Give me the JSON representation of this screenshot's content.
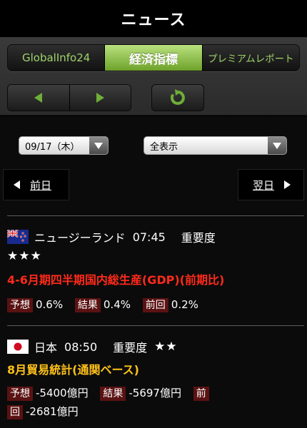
{
  "header": {
    "title": "ニュース"
  },
  "tabs": [
    {
      "label": "GlobalInfo24",
      "active": false
    },
    {
      "label": "経済指標",
      "active": true
    },
    {
      "label": "プレミアムレポート",
      "active": false
    }
  ],
  "filters": {
    "date_value": "09/17（木）",
    "display_value": "全表示"
  },
  "day_nav": {
    "prev_label": "前日",
    "next_label": "翌日"
  },
  "colors": {
    "accent_green": "#6fae38",
    "red_title": "#ff2a1a",
    "yellow_title": "#ffc21a",
    "label_bg": "#5a1212"
  },
  "events": [
    {
      "country": "ニュージーランド",
      "time": "07:45",
      "importance_label": "重要度",
      "stars": "★★★",
      "title": "4-6月期四半期国内総生産(GDP)(前期比)",
      "forecast_label": "予想",
      "forecast": "0.6%",
      "result_label": "結果",
      "result": "0.4%",
      "previous_label": "前回",
      "previous": "0.2%",
      "flag_icon": "nz-flag-icon"
    },
    {
      "country": "日本",
      "time": "08:50",
      "importance_label": "重要度",
      "stars": "★★",
      "title": "8月貿易統計(通関ベース)",
      "forecast_label": "予想",
      "forecast": "-5400億円",
      "result_label": "結果",
      "result": "-5697億円",
      "previous_label_1": "前",
      "previous_label_2": "回",
      "previous": "-2681億円",
      "flag_icon": "jp-flag-icon"
    }
  ]
}
